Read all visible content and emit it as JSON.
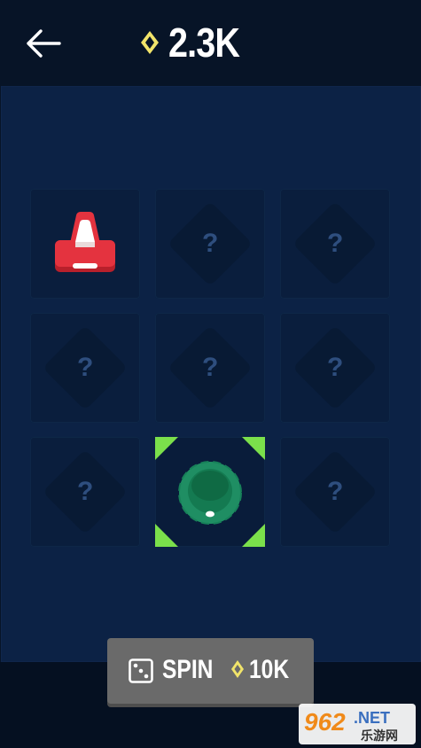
{
  "header": {
    "back_icon": "arrow-left-icon",
    "currency_icon": "diamond-gem-icon",
    "currency_amount": "2.3K"
  },
  "colors": {
    "background": "#071427",
    "board": "#0c2245",
    "tile": "#0a1e3d",
    "mystery_text": "#2e4e7e",
    "selection": "#7be04b",
    "gem": "#f1e46a",
    "button": "#6a6a6a"
  },
  "board": {
    "tiles": [
      {
        "state": "revealed",
        "item": "red-traffic-cone-icon"
      },
      {
        "state": "hidden",
        "label": "?"
      },
      {
        "state": "hidden",
        "label": "?"
      },
      {
        "state": "hidden",
        "label": "?"
      },
      {
        "state": "hidden",
        "label": "?"
      },
      {
        "state": "hidden",
        "label": "?"
      },
      {
        "state": "hidden",
        "label": "?"
      },
      {
        "state": "selected",
        "item": "green-puck-icon"
      },
      {
        "state": "hidden",
        "label": "?"
      }
    ]
  },
  "spin_button": {
    "dice_icon": "dice-icon",
    "label": "SPIN",
    "gem_icon": "diamond-gem-icon",
    "cost": "10K"
  },
  "watermark": {
    "number": "962",
    "suffix": ".NET",
    "chinese": "乐游网"
  }
}
